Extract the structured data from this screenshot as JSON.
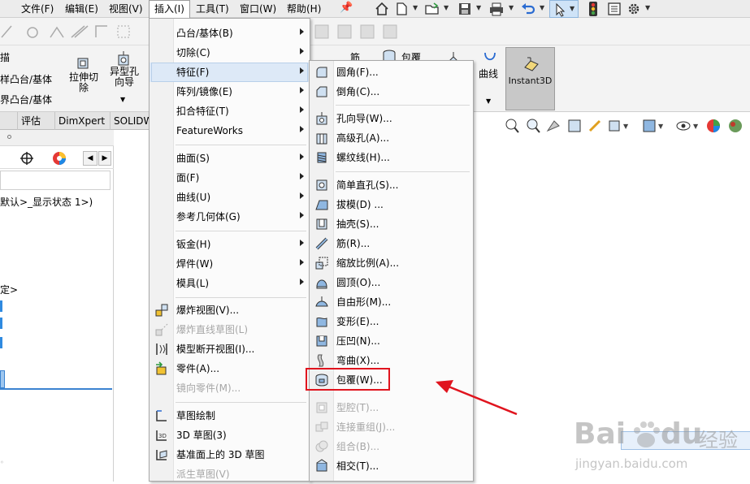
{
  "menubar": {
    "items": [
      {
        "label": "文件(F)"
      },
      {
        "label": "编辑(E)"
      },
      {
        "label": "视图(V)"
      },
      {
        "label": "插入(I)"
      },
      {
        "label": "工具(T)"
      },
      {
        "label": "窗口(W)"
      },
      {
        "label": "帮助(H)"
      }
    ]
  },
  "ribbon": {
    "left_texts": [
      "描",
      "样凸台/基体",
      "界凸台/基体"
    ],
    "btn_extrude_cut": "拉伸切\n除",
    "btn_hole_wizard": "异型孔\n向导",
    "btn_rib": "筋",
    "btn_wrap": "包覆",
    "btn_curves": "曲线",
    "btn_instant3d": "Instant3D"
  },
  "tabs": [
    "评估",
    "DimXpert",
    "SOLIDW"
  ],
  "leftpane": {
    "config_text": "默认>_显示状态 1>)",
    "text2": "定>"
  },
  "insert_menu": {
    "items": [
      {
        "label": "凸台/基体(B)",
        "submenu": true
      },
      {
        "label": "切除(C)",
        "submenu": true
      },
      {
        "label": "特征(F)",
        "submenu": true
      },
      {
        "label": "阵列/镜像(E)",
        "submenu": true
      },
      {
        "label": "扣合特征(T)",
        "submenu": true
      },
      {
        "label": "FeatureWorks",
        "submenu": true
      },
      {
        "label": "曲面(S)",
        "submenu": true
      },
      {
        "label": "面(F)",
        "submenu": true
      },
      {
        "label": "曲线(U)",
        "submenu": true
      },
      {
        "label": "参考几何体(G)",
        "submenu": true
      },
      {
        "label": "钣金(H)",
        "submenu": true
      },
      {
        "label": "焊件(W)",
        "submenu": true
      },
      {
        "label": "模具(L)",
        "submenu": true
      },
      {
        "label": "爆炸视图(V)..."
      },
      {
        "label": "爆炸直线草图(L)",
        "disabled": true
      },
      {
        "label": "模型断开视图(I)..."
      },
      {
        "label": "零件(A)..."
      },
      {
        "label": "镜向零件(M)...",
        "disabled": true
      },
      {
        "label": "草图绘制"
      },
      {
        "label": "3D 草图(3)"
      },
      {
        "label": "基准面上的 3D 草图"
      },
      {
        "label": "派生草图(V)",
        "disabled": true
      }
    ]
  },
  "feature_menu": {
    "items": [
      {
        "label": "圆角(F)..."
      },
      {
        "label": "倒角(C)..."
      },
      {
        "label": "孔向导(W)..."
      },
      {
        "label": "高级孔(A)..."
      },
      {
        "label": "螺纹线(H)..."
      },
      {
        "label": "简单直孔(S)..."
      },
      {
        "label": "拔模(D) ..."
      },
      {
        "label": "抽壳(S)..."
      },
      {
        "label": "筋(R)..."
      },
      {
        "label": "缩放比例(A)..."
      },
      {
        "label": "圆顶(O)..."
      },
      {
        "label": "自由形(M)..."
      },
      {
        "label": "变形(E)..."
      },
      {
        "label": "压凹(N)..."
      },
      {
        "label": "弯曲(X)..."
      },
      {
        "label": "包覆(W)..."
      },
      {
        "label": "型腔(T)...",
        "disabled": true
      },
      {
        "label": "连接重组(J)...",
        "disabled": true
      },
      {
        "label": "组合(B)...",
        "disabled": true
      },
      {
        "label": "相交(T)..."
      }
    ]
  },
  "watermark": {
    "brand": "Bai",
    "brand2": "du",
    "cn": "经验",
    "url": "jingyan.baidu.com"
  },
  "colors": {
    "highlight_red": "#e0141e",
    "menu_hover": "#dde9f7",
    "accent_blue": "#2a6bd1"
  }
}
